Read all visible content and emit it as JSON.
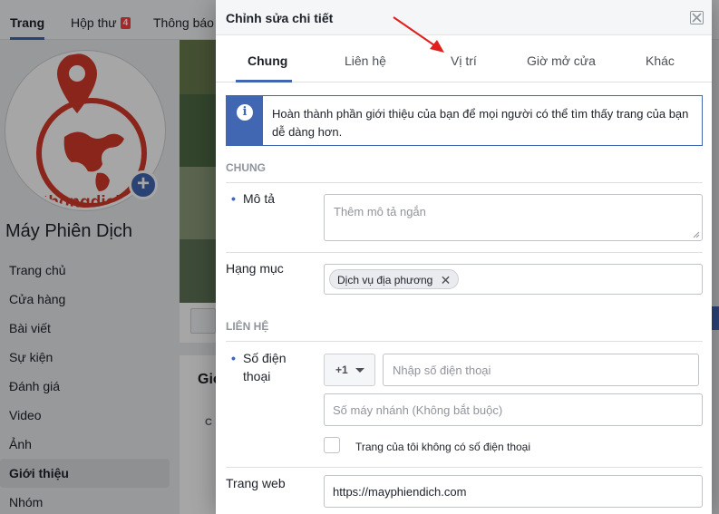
{
  "background": {
    "topnav": {
      "tabs": [
        {
          "label": "Trang"
        },
        {
          "label": "Hộp thư"
        },
        {
          "label": "Thông báo"
        }
      ],
      "inbox_badge": "4"
    },
    "profile": {
      "logo_text": "thongdich",
      "page_name": "Máy Phiên Dịch"
    },
    "nav": [
      {
        "label": "Trang chủ"
      },
      {
        "label": "Cửa hàng"
      },
      {
        "label": "Bài viết"
      },
      {
        "label": "Sự kiện"
      },
      {
        "label": "Đánh giá"
      },
      {
        "label": "Video"
      },
      {
        "label": "Ảnh"
      },
      {
        "label": "Giới thiệu"
      },
      {
        "label": "Nhóm"
      }
    ],
    "card_title": "Giớ",
    "card_sub": "C"
  },
  "modal": {
    "title": "Chỉnh sửa chi tiết",
    "tabs": [
      {
        "label": "Chung"
      },
      {
        "label": "Liên hệ"
      },
      {
        "label": "Vị trí"
      },
      {
        "label": "Giờ mở cửa"
      },
      {
        "label": "Khác"
      }
    ],
    "info_text": "Hoàn thành phần giới thiệu của bạn để mọi người có thể tìm thấy trang của bạn dễ dàng hơn.",
    "sections": {
      "general_heading": "CHUNG",
      "contact_heading": "LIÊN HỆ"
    },
    "description": {
      "label": "Mô tả",
      "placeholder": "Thêm mô tả ngắn"
    },
    "category": {
      "label": "Hạng mục",
      "chip": "Dịch vụ địa phương"
    },
    "phone": {
      "label_line1": "Số điện",
      "label_line2": "thoại",
      "country_code": "+1",
      "placeholder": "Nhập số điện thoại",
      "extension_placeholder": "Số máy nhánh (Không bắt buộc)",
      "no_phone_label": "Trang của tôi không có số điện thoại"
    },
    "website": {
      "label": "Trang web",
      "value": "https://mayphiendich.com"
    }
  },
  "colors": {
    "accent": "#4267b2",
    "annotation_arrow": "#e0201c"
  }
}
